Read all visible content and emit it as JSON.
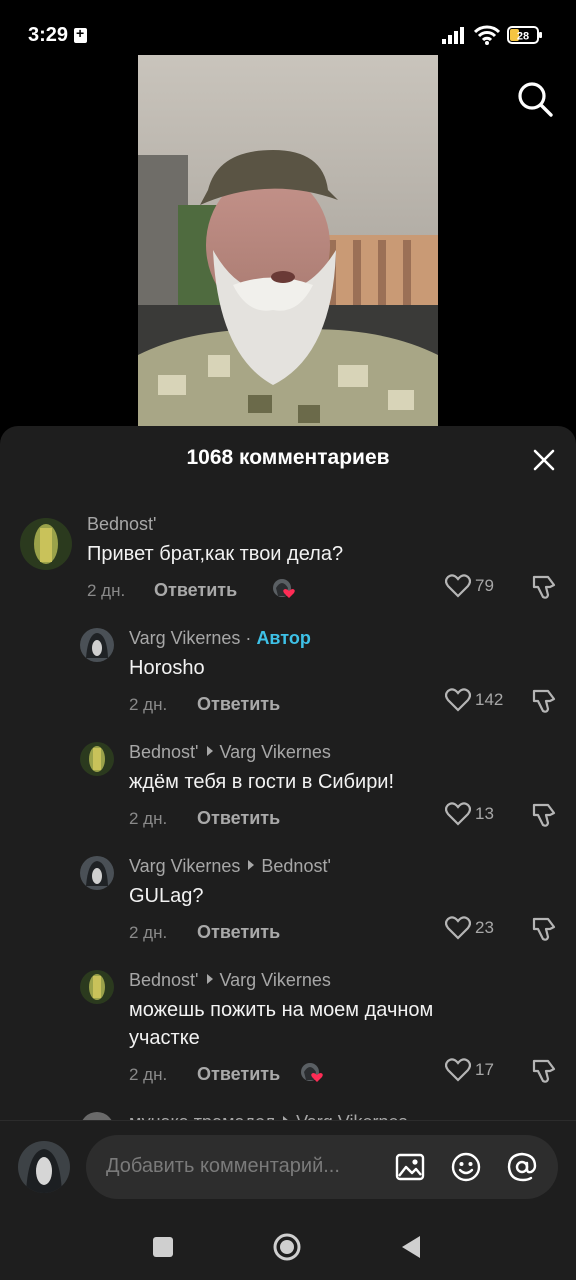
{
  "status": {
    "time": "3:29",
    "battery": "28"
  },
  "sheet": {
    "title": "1068 комментариев",
    "input_placeholder": "Добавить комментарий..."
  },
  "comments": [
    {
      "author": "Bednost'",
      "text": "Привет брат,как твои дела?",
      "time": "2 дн.",
      "reply": "Ответить",
      "likes": "79"
    },
    {
      "author": "Varg Vikernes",
      "separator": "·",
      "tag": "Автор",
      "text": "Horosho",
      "time": "2 дн.",
      "reply": "Ответить",
      "likes": "142"
    },
    {
      "author": "Bednost'",
      "reply_to": "Varg Vikernes",
      "text": "ждём тебя в гости в Сибири!",
      "time": "2 дн.",
      "reply": "Ответить",
      "likes": "13"
    },
    {
      "author": "Varg Vikernes",
      "reply_to": "Bednost'",
      "text": "GULag?",
      "time": "2 дн.",
      "reply": "Ответить",
      "likes": "23"
    },
    {
      "author": "Bednost'",
      "reply_to": "Varg Vikernes",
      "text": "можешь пожить на моем дачном участке",
      "time": "2 дн.",
      "reply": "Ответить",
      "likes": "17"
    },
    {
      "author": "мунака трамадол",
      "reply_to": "Varg Vikernes"
    }
  ],
  "colors": {
    "author_tag": "#3ec1e7",
    "heart": "#fe2c55",
    "sheet_bg": "#1e1e1e"
  }
}
